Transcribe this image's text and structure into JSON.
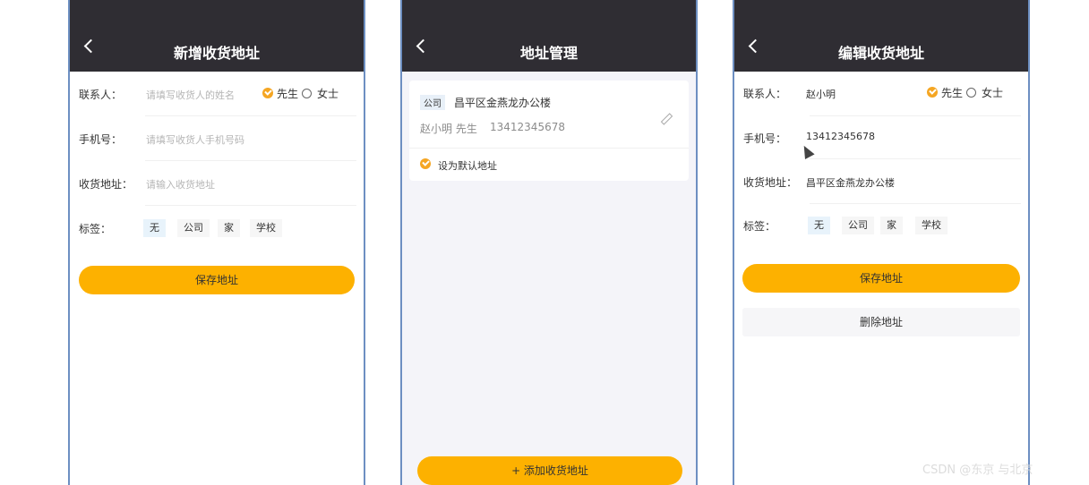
{
  "screens": [
    {
      "title": "新增收货地址",
      "contact_label": "联系人：",
      "contact_placeholder": "请填写收货人的姓名",
      "gender_male": "先生",
      "gender_female": "女士",
      "gender_selected": "先生",
      "phone_label": "手机号：",
      "phone_placeholder": "请填写收货人手机号码",
      "address_label": "收货地址：",
      "address_placeholder": "请输入收货地址",
      "tag_label": "标签：",
      "tags": [
        "无",
        "公司",
        "家",
        "学校"
      ],
      "tag_selected": "无",
      "save_button": "保存地址"
    },
    {
      "title": "地址管理",
      "address_card": {
        "tag": "公司",
        "address": "昌平区金燕龙办公楼",
        "name": "赵小明",
        "gender": "先生",
        "phone": "13412345678",
        "default_label": "设为默认地址"
      },
      "add_button": "+ 添加收货地址"
    },
    {
      "title": "编辑收货地址",
      "contact_label": "联系人：",
      "contact_value": "赵小明",
      "gender_male": "先生",
      "gender_female": "女士",
      "gender_selected": "先生",
      "phone_label": "手机号：",
      "phone_value": "13412345678",
      "address_label": "收货地址：",
      "address_value": "昌平区金燕龙办公楼",
      "tag_label": "标签：",
      "tags": [
        "无",
        "公司",
        "家",
        "学校"
      ],
      "tag_selected": "无",
      "save_button": "保存地址",
      "delete_button": "删除地址"
    }
  ],
  "watermark": "CSDN @东京 与北京",
  "colors": {
    "header_bg": "#2f2d33",
    "accent": "#fdb100",
    "radio_checked": "#f5a623",
    "tag_active": "#e8f3fb",
    "frame_border": "#6d8fc2"
  },
  "icons": {
    "back": "chevron-left-icon",
    "edit": "pencil-icon",
    "radio_checked": "radio-checked-icon",
    "radio_unchecked": "radio-unchecked-icon",
    "cursor": "mouse-cursor-icon"
  }
}
